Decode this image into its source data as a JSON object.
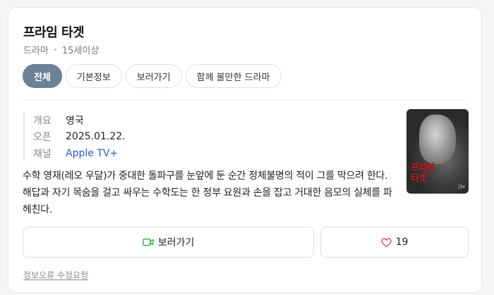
{
  "title": "프라임 타겟",
  "meta": {
    "genre": "드라마",
    "rating": "15세이상"
  },
  "tabs": [
    {
      "label": "전체",
      "active": true
    },
    {
      "label": "기본정보",
      "active": false
    },
    {
      "label": "보러가기",
      "active": false
    },
    {
      "label": "함께 볼만한 드라마",
      "active": false
    }
  ],
  "info": {
    "overview_label": "개요",
    "overview_value": "영국",
    "open_label": "오픈",
    "open_value": "2025.01.22.",
    "channel_label": "채널",
    "channel_value": "Apple TV+"
  },
  "description": "수학 영재(레오 우달)가 중대한 돌파구를 눈앞에 둔 순간 정체불명의 적이 그를 막으려 한다. 해답과 자기 목숨을 걸고 싸우는 수학도는 한 정부 요원과 손을 잡고 거대한 음모의 실체를 파헤친다.",
  "poster": {
    "title_line1": "프라임",
    "title_line2": "타겟"
  },
  "actions": {
    "watch_label": "보러가기",
    "like_count": "19"
  },
  "footer": {
    "report_label": "정보오류 수정요청"
  },
  "colors": {
    "active_tab": "#6b8196",
    "link": "#2a5bd7",
    "watch_icon": "#2db84d",
    "heart_icon": "#e0425a"
  }
}
